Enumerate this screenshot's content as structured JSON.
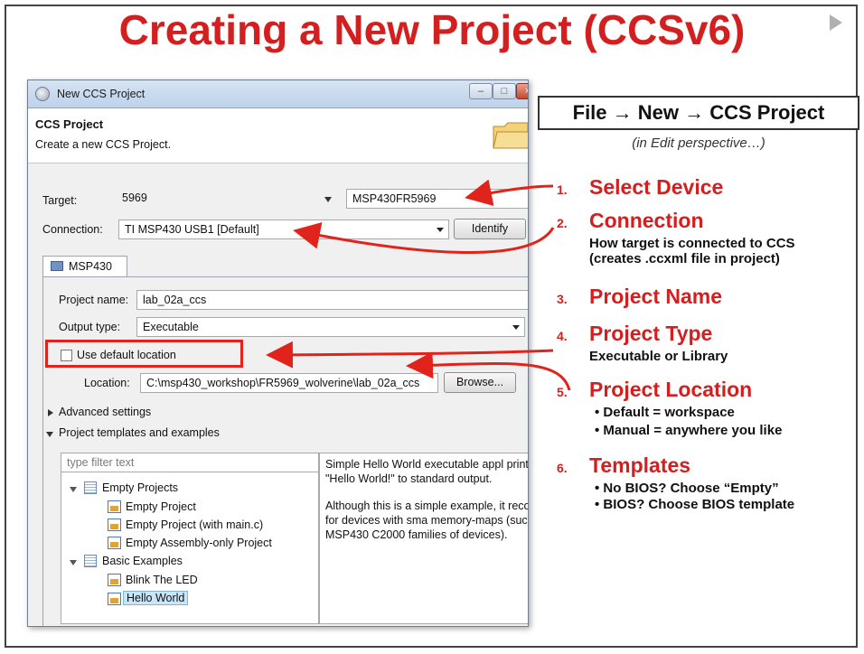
{
  "slide": {
    "title": "Creating a New Project (CCSv6)"
  },
  "dialog": {
    "window_title": "New CCS Project",
    "header_title": "CCS Project",
    "header_subtitle": "Create a new CCS Project.",
    "target_label": "Target:",
    "target_family_value": "5969",
    "target_device_value": "MSP430FR5969",
    "connection_label": "Connection:",
    "connection_value": "TI MSP430 USB1 [Default]",
    "identify_button": "Identify",
    "tab_label": "MSP430",
    "project_name_label": "Project name:",
    "project_name_value": "lab_02a_ccs",
    "output_type_label": "Output type:",
    "output_type_value": "Executable",
    "use_default_location_label": "Use default location",
    "use_default_location_checked": false,
    "location_label": "Location:",
    "location_value": "C:\\msp430_workshop\\FR5969_wolverine\\lab_02a_ccs",
    "browse_button": "Browse...",
    "advanced_settings": "Advanced settings",
    "templates_section": "Project templates and examples",
    "filter_placeholder": "type filter text",
    "tree": [
      {
        "label": "Empty Projects",
        "children": [
          "Empty Project",
          "Empty Project (with main.c)",
          "Empty Assembly-only Project"
        ]
      },
      {
        "label": "Basic Examples",
        "children": [
          "Blink The LED",
          "Hello World"
        ]
      }
    ],
    "selected_template": "Hello World",
    "description_p1": "Simple Hello World executable appl printing the string \"Hello World!\" to standard output.",
    "description_p2": "Although this is a simple example, it recommended for devices with sma memory-maps (such as the MSP430 C2000 families of devices)."
  },
  "sidebar": {
    "path_heading": "File → New → CCS Project",
    "path_note": "(in Edit perspective…)",
    "steps": [
      {
        "num": "1.",
        "title": "Select Device"
      },
      {
        "num": "2.",
        "title": "Connection",
        "desc1": "How target is connected to CCS",
        "desc2": "(creates .ccxml file in project)"
      },
      {
        "num": "3.",
        "title": "Project Name"
      },
      {
        "num": "4.",
        "title": "Project Type",
        "desc1": "Executable or Library"
      },
      {
        "num": "5.",
        "title": "Project Location",
        "bullet1": "• Default = workspace",
        "bullet2": "• Manual = anywhere you like"
      },
      {
        "num": "6.",
        "title": "Templates",
        "bullet1": "• No BIOS? Choose “Empty”",
        "bullet2": "• BIOS? Choose BIOS template"
      }
    ]
  },
  "colors": {
    "accent_red": "#d31f1f",
    "highlight_border": "#e0231b"
  }
}
